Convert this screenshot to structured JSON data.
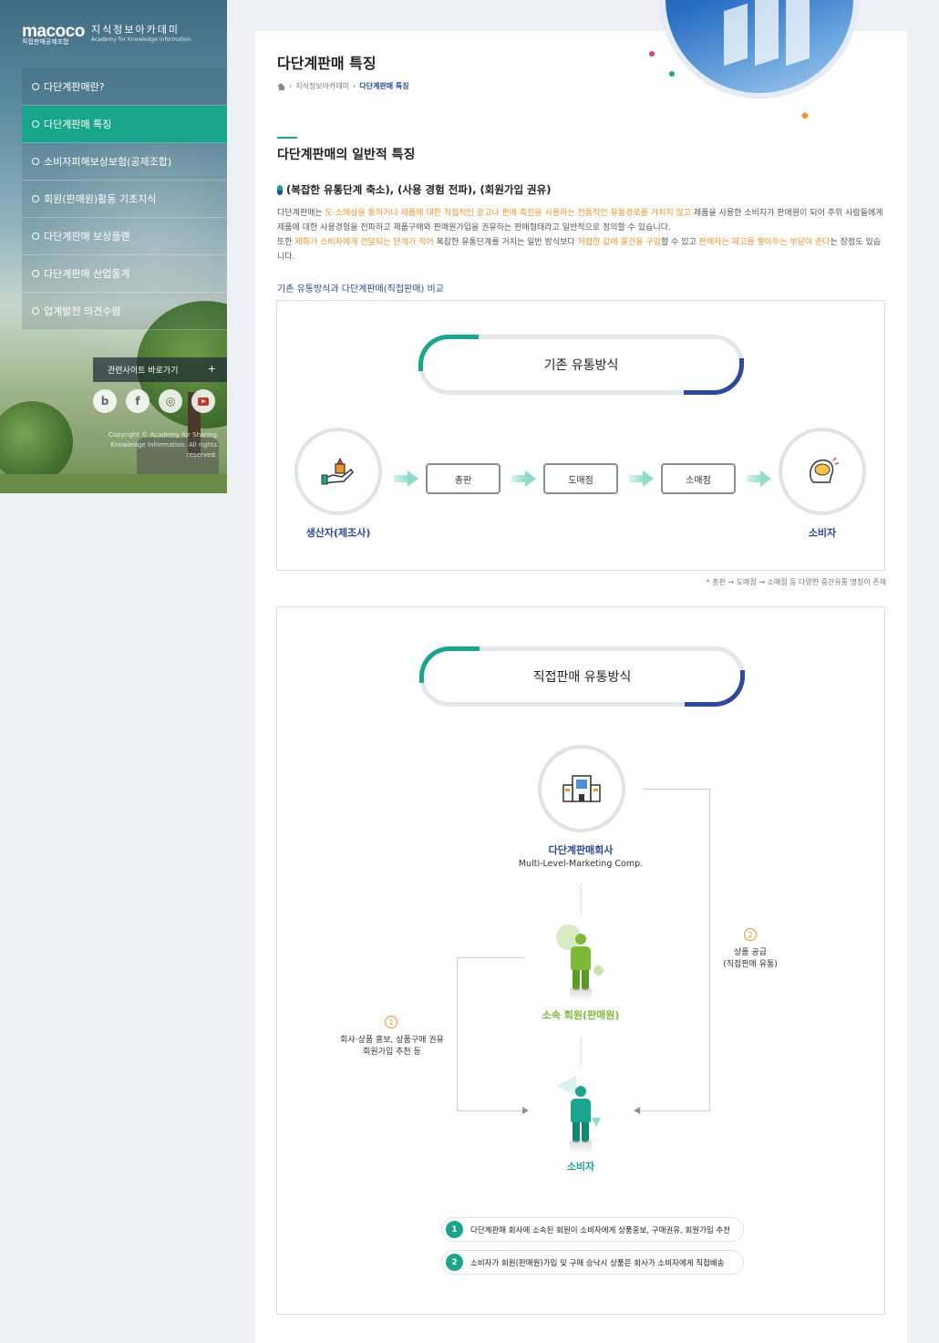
{
  "sidebar": {
    "logo": {
      "mark": "macoco",
      "title": "지식정보아카데미",
      "sub": "직접판매공제조합",
      "en_sub": "Academy for Knowledge Information"
    },
    "menu": [
      {
        "label": "다단계판매란?",
        "active": false
      },
      {
        "label": "다단계판매 특징",
        "active": true
      },
      {
        "label": "소비자피해보상보험(공제조합)",
        "active": false
      },
      {
        "label": "회원(판매원)활동 기초지식",
        "active": false
      },
      {
        "label": "다단계판매 보상플랜",
        "active": false
      },
      {
        "label": "다단계판매 산업통계",
        "active": false
      },
      {
        "label": "업계발전 의견수렴",
        "active": false
      }
    ],
    "related_label": "관련사이트 바로가기",
    "related_plus": "+",
    "social": [
      {
        "icon": "blog-icon",
        "glyph": "b"
      },
      {
        "icon": "facebook-icon",
        "glyph": "f"
      },
      {
        "icon": "instagram-icon",
        "glyph": "◎"
      },
      {
        "icon": "youtube-icon",
        "glyph": ""
      }
    ],
    "copyright_1": "Copyright © Academy for Sharing",
    "copyright_2": "Knowledge Information. All rights reserved."
  },
  "main": {
    "title": "다단계판매 특징",
    "breadcrumb": [
      "지식정보아카데미",
      "다단계판매 특징"
    ],
    "section_title": "다단계판매의 일반적 특징",
    "sub_title": "(복잡한 유통단계 축소), (사용 경험 전파), (회원가입 권유)",
    "desc": {
      "p1_a": "다단계판매는 ",
      "p1_hl1": "도·소매상을 통하거나 제품에 대한 직접적인 광고나 판매 촉진을 사용하는 전통적인 유통경로를 거치지 않고",
      "p1_b": " 제품을 사용한 소비자가 판매원이 되어 주위 사람들에게 제품에 대한 사용경험을 전파하고 제품구매와 판매원가입을 권유하는 판매형태라고 일반적으로 정의할 수 있습니다.",
      "p2_a": "또한 ",
      "p2_hl1": "제화가 소비자에게 전달되는 단계가 적어",
      "p2_b": " 복잡한 유통단계를 거치는 일반 방식보다 ",
      "p2_hl2": "저렴한 값에 물건을 구입",
      "p2_c": "할 수 있고 ",
      "p2_hl3": "판매자는 재고를 쌓아두는 부담이 준다",
      "p2_d": "는 장점도 있습니다."
    },
    "compare_title": "기존 유통방식과 다단계판매(직접판매) 비교",
    "diagram1": {
      "title": "기존 유통방식",
      "producer": "생산자(제조사)",
      "steps": [
        "총판",
        "도매점",
        "소매점"
      ],
      "consumer": "소비자"
    },
    "note": "* 총판 → 도매점 → 소매점 등 다양한 중간유통 명칭이 존재",
    "diagram2": {
      "title": "직접판매 유통방식",
      "company": "다단계판매회사",
      "company_en": "Multi-Level-Marketing Comp.",
      "member": "소속 회원(판매원)",
      "consumer": "소비자",
      "num1": "1",
      "side1_l1": "회사·상품 홍보, 상품구매 권유",
      "side1_l2": "회원가입 추천 등",
      "num2": "2",
      "side2_l1": "상품 공급",
      "side2_l2": "(직접판매 유통)",
      "legend": [
        {
          "n": "1",
          "text": "다단계판매 회사에 소속된 회원이 소비자에게 상품홍보, 구매권유, 회원가입 추천"
        },
        {
          "n": "2",
          "text": "소비자가 회원(판매원)가입 및 구매 승낙시 상품은 회사가 소비자에게 직접배송"
        }
      ]
    }
  },
  "colors": {
    "accent_green": "#19a58c",
    "accent_navy": "#2b4a9a",
    "highlight_orange": "#f0932b",
    "member_green": "#7cbb3a"
  }
}
